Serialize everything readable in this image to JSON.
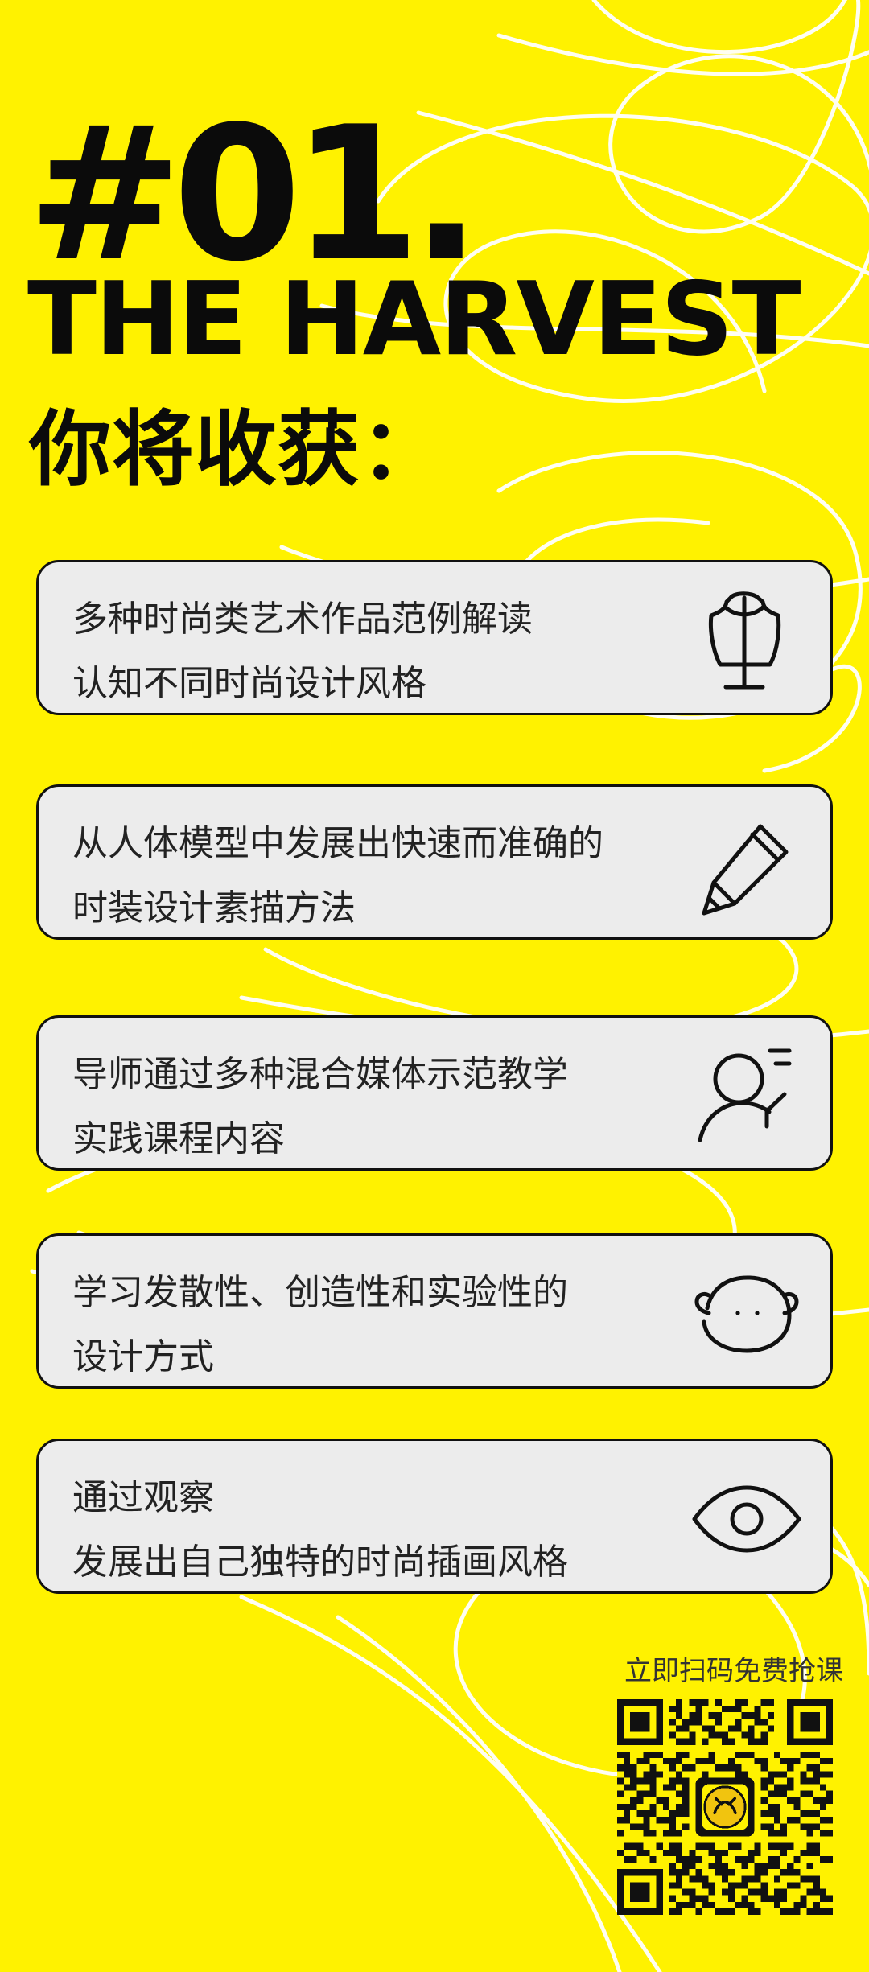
{
  "hero": {
    "number": "#01.",
    "title": "THE HARVEST",
    "subtitle": "你将收获："
  },
  "cards": [
    {
      "lines": [
        "多种时尚类艺术作品范例解读",
        "认知不同时尚设计风格"
      ],
      "icon": "dress-form-icon"
    },
    {
      "lines": [
        "从人体模型中发展出快速而准确的",
        "时装设计素描方法"
      ],
      "icon": "pencil-icon"
    },
    {
      "lines": [
        "导师通过多种混合媒体示范教学",
        "实践课程内容"
      ],
      "icon": "instructor-icon"
    },
    {
      "lines": [
        "学习发散性、创造性和实验性的",
        "设计方式"
      ],
      "icon": "face-icon"
    },
    {
      "lines": [
        "通过观察",
        "发展出自己独特的时尚插画风格"
      ],
      "icon": "eye-icon"
    }
  ],
  "cta": {
    "label": "立即扫码免费抢课",
    "qr_icon": "qr-code-icon"
  },
  "colors": {
    "background": "#fff200",
    "ink": "#0b0b0b",
    "card": "#ececec",
    "scribble": "#ffffff"
  }
}
